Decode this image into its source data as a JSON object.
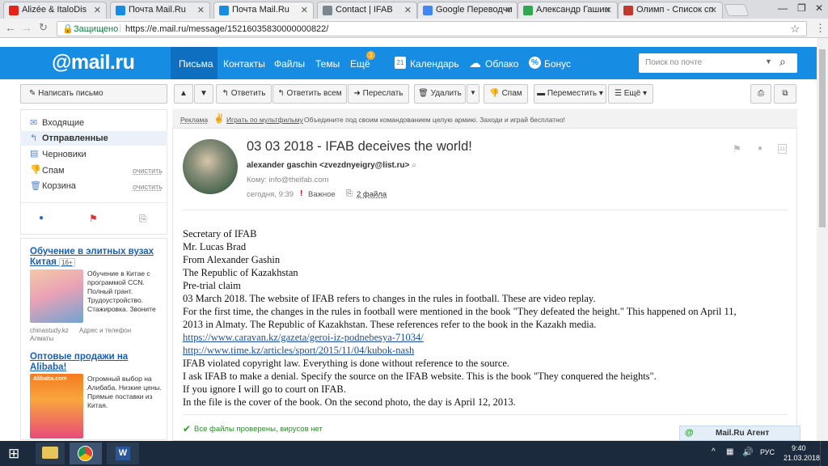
{
  "browser": {
    "tabs": [
      {
        "label": "Alizée & ItaloDis",
        "color": "#e62117"
      },
      {
        "label": "Почта Mail.Ru",
        "color": "#168de2"
      },
      {
        "label": "Почта Mail.Ru",
        "color": "#168de2"
      },
      {
        "label": "Contact | IFAB",
        "color": "#7a8791"
      },
      {
        "label": "Google Переводчи",
        "color": "#4285f4"
      },
      {
        "label": "Александр Гашин",
        "color": "#2fa84f"
      },
      {
        "label": "Олимп - Список сп",
        "color": "#c0392b"
      }
    ],
    "secure_label": "Защищено",
    "url": "https://e.mail.ru/message/15216035830000000822/"
  },
  "header": {
    "logo": "@mail.ru",
    "nav": [
      "Письма",
      "Контакты",
      "Файлы",
      "Темы",
      "Ещё"
    ],
    "nav_badge": "3",
    "calendar_day": "21",
    "calendar": "Календарь",
    "cloud": "Облако",
    "bonus": "Бонус",
    "search_placeholder": "Поиск по почте"
  },
  "toolbar": {
    "compose": "Написать письмо",
    "reply": "Ответить",
    "reply_all": "Ответить всем",
    "forward": "Переслать",
    "delete": "Удалить",
    "spam": "Спам",
    "move": "Переместить",
    "more": "Ещё"
  },
  "sidebar": {
    "folders": [
      {
        "label": "Входящие",
        "action": ""
      },
      {
        "label": "Отправленные",
        "action": ""
      },
      {
        "label": "Черновики",
        "action": ""
      },
      {
        "label": "Спам",
        "action": "очистить"
      },
      {
        "label": "Корзина",
        "action": "очистить"
      }
    ],
    "ads": [
      {
        "title": "Обучение в элитных вузах Китая",
        "badge": "16+",
        "text": "Обучение в Китае с программой CCN. Полный грант. Трудоустройство. Стажировка. Звоните",
        "source": "chinastudy.kz",
        "source2": "Адрес и телефон",
        "city": "Алматы"
      },
      {
        "title": "Оптовые продажи на Alibaba!",
        "text": "Огромный выбор на Алибаба. Низкие цены. Прямые поставки из Китая.",
        "banner": "Alibaba.com"
      }
    ]
  },
  "ad_banner": {
    "label": "Реклама",
    "link": "Играть по мультфильму",
    "text": "Объедините под своим командованием целую армию. Заходи и играй бесплатно!"
  },
  "message": {
    "subject": "03 03 2018 - IFAB deceives the world!",
    "from": "alexander gaschin <zvezdnyeigry@list.ru>",
    "to": "Кому: info@theifab.com",
    "date": "сегодня, 9:39",
    "important": "Важное",
    "attachments": "2 файла",
    "body": [
      "Secretary of IFAB",
      "Mr. Lucas Brad",
      "From Alexander Gashin",
      "The Republic of Kazakhstan",
      "Pre-trial claim",
      "03 March 2018. The website of IFAB refers to changes in the rules in football. These are video replay.",
      "For the first time, the changes in the rules in football were mentioned in the book \"They defeated the height.\" This happened on April 11,",
      "2013 in Almaty. The Republic of Kazakhstan. These references refer to the book in the Kazakh media."
    ],
    "links": [
      "https://www.caravan.kz/gazeta/geroi-iz-podnebesya-71034/",
      "http://www.time.kz/articles/sport/2015/11/04/kubok-nash"
    ],
    "body2": [
      "IFAB violated copyright law. Everything is done without reference to the source.",
      "I ask IFAB to make a denial. Specify the source on the IFAB website. This is the book \"They conquered the heights\".",
      "If you ignore I will go to court on IFAB.",
      "In the file is the cover of the book. On the second photo, the day is April 12, 2013."
    ],
    "virus_check": "Все файлы проверены, вирусов нет"
  },
  "agent": {
    "label": "Mail.Ru Агент"
  },
  "taskbar": {
    "lang": "РУС",
    "time": "9:40",
    "date": "21.03.2018"
  }
}
